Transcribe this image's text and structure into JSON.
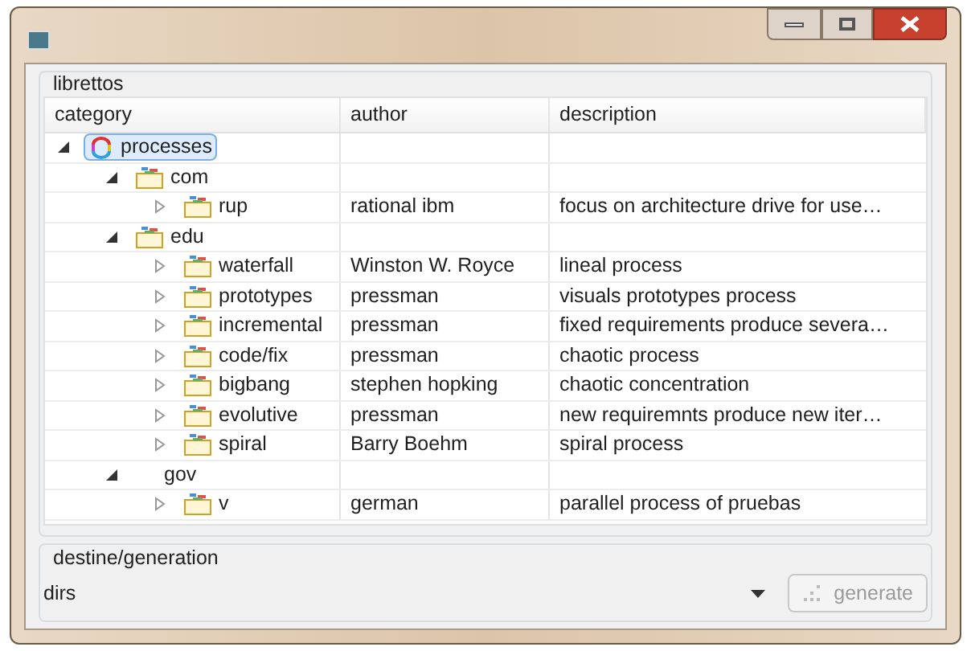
{
  "group_title": "librettos",
  "table": {
    "columns": [
      "category",
      "author",
      "description"
    ],
    "rows": [
      {
        "kind": "root",
        "name": "processes",
        "expanded": true,
        "selected": true,
        "children": [
          {
            "kind": "folder",
            "name": "com",
            "expanded": true,
            "selected": false,
            "children": [
              {
                "kind": "folder",
                "name": "rup",
                "author": "rational ibm",
                "description": "focus on architecture drive for use…",
                "expanded": false,
                "selected": false
              }
            ]
          },
          {
            "kind": "folder",
            "name": "edu",
            "expanded": true,
            "selected": false,
            "children": [
              {
                "kind": "folder",
                "name": "waterfall",
                "author": "Winston W. Royce",
                "description": "lineal process",
                "expanded": false,
                "selected": false
              },
              {
                "kind": "folder",
                "name": "prototypes",
                "author": "pressman",
                "description": "visuals prototypes process",
                "expanded": false,
                "selected": false
              },
              {
                "kind": "folder",
                "name": "incremental",
                "author": "pressman",
                "description": "fixed requirements produce severa…",
                "expanded": false,
                "selected": false
              },
              {
                "kind": "folder",
                "name": "code/fix",
                "author": "pressman",
                "description": "chaotic process",
                "expanded": false,
                "selected": false
              },
              {
                "kind": "folder",
                "name": "bigbang",
                "author": "stephen hopking",
                "description": "chaotic concentration",
                "expanded": false,
                "selected": false
              },
              {
                "kind": "folder",
                "name": "evolutive",
                "author": "pressman",
                "description": "new requiremnts produce new iter…",
                "expanded": false,
                "selected": false
              },
              {
                "kind": "folder",
                "name": "spiral",
                "author": "Barry Boehm",
                "description": "spiral process",
                "expanded": false,
                "selected": false
              }
            ]
          },
          {
            "kind": "plain",
            "name": "gov",
            "expanded": true,
            "selected": false,
            "children": [
              {
                "kind": "folder",
                "name": "v",
                "author": "german",
                "description": "parallel process of pruebas",
                "expanded": false,
                "selected": false
              }
            ]
          }
        ]
      }
    ]
  },
  "destination": {
    "title": "destine/generation",
    "value": "dirs",
    "button": {
      "label": "generate",
      "disabled": true
    }
  }
}
